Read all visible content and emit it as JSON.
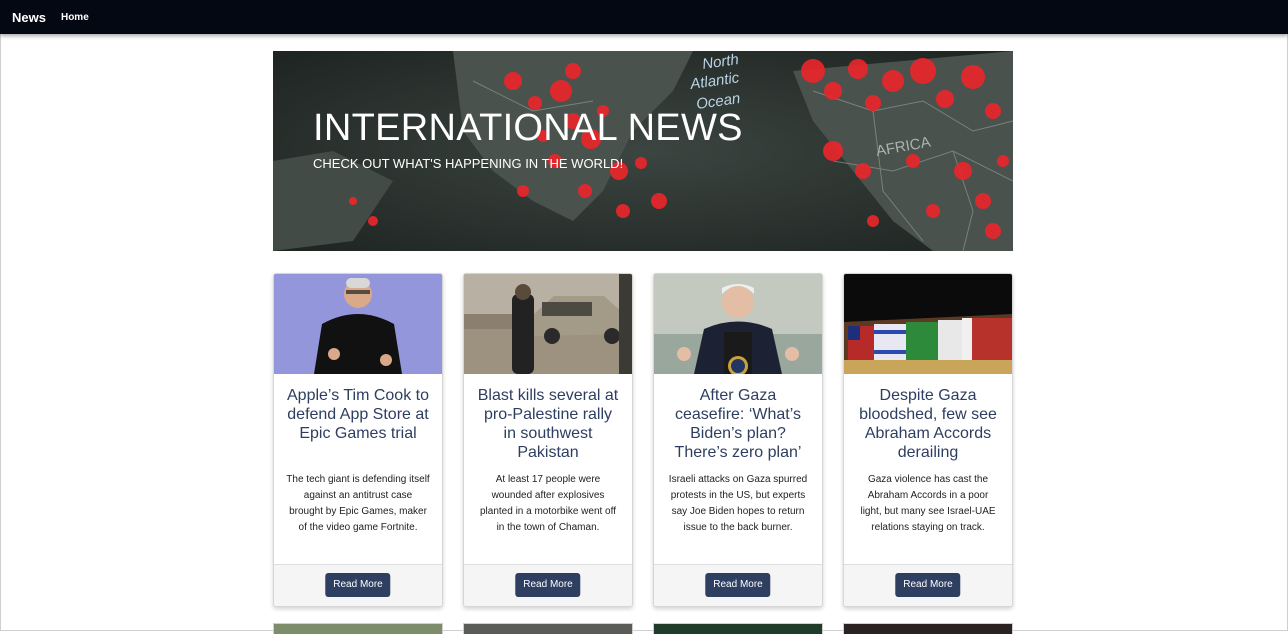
{
  "navbar": {
    "brand": "News",
    "home_label": "Home"
  },
  "hero": {
    "title": "INTERNATIONAL NEWS",
    "subtitle": "CHECK OUT WHAT'S HAPPENING IN THE WORLD!",
    "map_labels": [
      "North",
      "Atlantic",
      "Ocean",
      "AFRICA"
    ]
  },
  "cards": [
    {
      "title": "Apple’s Tim Cook to defend App Store at Epic Games trial",
      "description": "The tech giant is defending itself against an antitrust case brought by Epic Games, maker of the video game Fortnite.",
      "button": "Read More"
    },
    {
      "title": "Blast kills several at pro-Palestine rally in southwest Pakistan",
      "description": "At least 17 people were wounded after explosives planted in a motorbike went off in the town of Chaman.",
      "button": "Read More"
    },
    {
      "title": "After Gaza ceasefire: ‘What’s Biden’s plan? There’s zero plan’",
      "description": "Israeli attacks on Gaza spurred protests in the US, but experts say Joe Biden hopes to return issue to the back burner.",
      "button": "Read More"
    },
    {
      "title": "Despite Gaza bloodshed, few see Abraham Accords derailing",
      "description": "Gaza violence has cast the Abraham Accords in a poor light, but many see Israel-UAE relations staying on track.",
      "button": "Read More"
    }
  ],
  "colors": {
    "navbar": "#030812",
    "button": "#2f3f62",
    "title": "#2e3e60",
    "accent_red": "#e8262a"
  }
}
